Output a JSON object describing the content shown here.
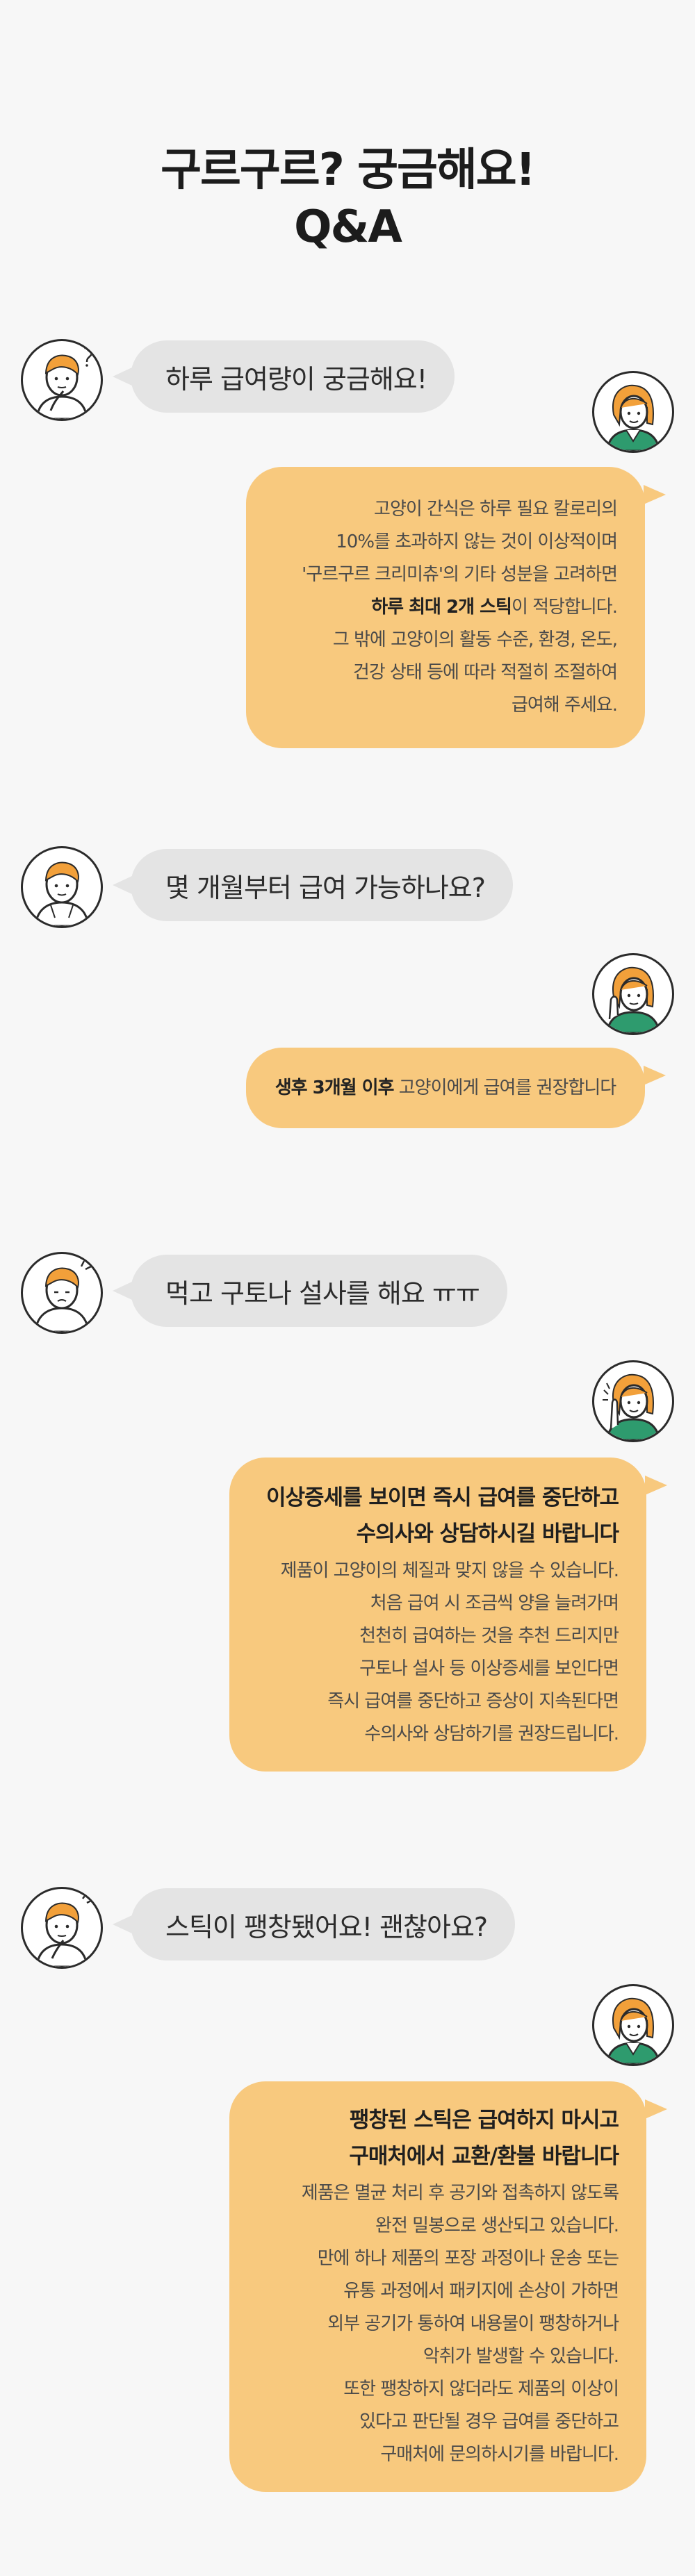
{
  "title": {
    "line1": "구르구르? 궁금해요!",
    "line2": "Q&A"
  },
  "qa": [
    {
      "question": "하루 급여량이 궁금해요!",
      "answer_lines": [
        "고양이 간식은 하루 필요 칼로리의",
        "10%를  초과하지 않는 것이 이상적이며",
        "'구르구르 크리미츄'의 기타 성분을 고려하면",
        "이 적당합니다.",
        "그 밖에 고양이의 활동 수준, 환경, 온도,",
        "건강 상태 등에 따라  적절히 조절하여",
        "급여해  주세요."
      ],
      "answer_strong": "하루 최대 2개 스틱"
    },
    {
      "question": "몇 개월부터 급여 가능하나요?",
      "answer_strong": "생후 3개월 이후",
      "answer_rest": " 고양이에게 급여를 권장합니다"
    },
    {
      "question": "먹고 구토나 설사를 해요 ㅠㅠ",
      "answer_head": [
        "이상증세를 보이면 즉시 급여를 중단하고",
        "수의사와 상담하시길 바랍니다"
      ],
      "answer_lines": [
        "제품이 고양이의 체질과 맞지 않을 수 있습니다.",
        "처음 급여 시 조금씩 양을 늘려가며",
        "천천히 급여하는 것을 추천 드리지만",
        "구토나 설사 등 이상증세를 보인다면",
        "즉시 급여를 중단하고 증상이 지속된다면",
        "수의사와 상담하기를 권장드립니다."
      ]
    },
    {
      "question": "스틱이 팽창됐어요! 괜찮아요?",
      "answer_head": [
        "팽창된 스틱은 급여하지 마시고",
        "구매처에서 교환/환불 바랍니다"
      ],
      "answer_lines": [
        "제품은 멸균 처리 후 공기와 접촉하지 않도록",
        "완전 밀봉으로 생산되고 있습니다.",
        "만에 하나 제품의 포장 과정이나 운송 또는",
        "유통 과정에서 패키지에 손상이 가하면",
        "외부 공기가 통하여 내용물이 팽창하거나",
        "악취가 발생할 수 있습니다.",
        "또한 팽창하지 않더라도 제품의 이상이",
        "있다고 판단될 경우 급여를 중단하고",
        "구매처에 문의하시기를 바랍니다."
      ]
    }
  ],
  "colors": {
    "background": "#f7f7f7",
    "question_bubble": "#e4e4e4",
    "answer_bubble": "#f8c97e",
    "hair_orange": "#f2a03a",
    "shirt_green": "#2e9b6e"
  },
  "icons": {
    "asker": "boy-avatar-icon",
    "answerer": "woman-avatar-icon"
  }
}
